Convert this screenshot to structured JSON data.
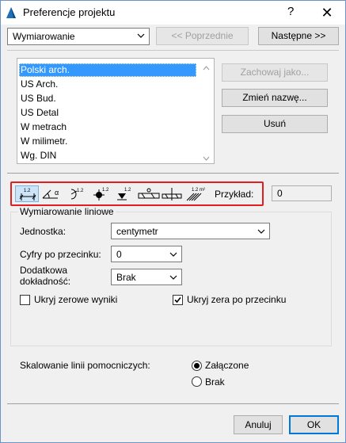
{
  "window": {
    "title": "Preferencje projektu",
    "help_glyph": "?",
    "close_glyph": "✕"
  },
  "top": {
    "category_value": "Wymiarowanie",
    "prev_label": "<< Poprzednie",
    "next_label": "Następne >>"
  },
  "presets": {
    "items": [
      {
        "label": "Polski arch.",
        "selected": true
      },
      {
        "label": "US Arch.",
        "selected": false
      },
      {
        "label": "US Bud.",
        "selected": false
      },
      {
        "label": "US Detal",
        "selected": false
      },
      {
        "label": "W metrach",
        "selected": false
      },
      {
        "label": "W milimetr.",
        "selected": false
      },
      {
        "label": "Wg. DIN",
        "selected": false
      }
    ],
    "save_as_label": "Zachowaj jako...",
    "rename_label": "Zmień nazwę...",
    "delete_label": "Usuń"
  },
  "dim_toolbar": {
    "icons": [
      {
        "name": "linear-dimension-icon",
        "sup": "1.2",
        "active": true
      },
      {
        "name": "angular-dimension-icon",
        "sup": "α",
        "active": false
      },
      {
        "name": "radial-dimension-icon",
        "sup": "1.2",
        "active": false
      },
      {
        "name": "level-dimension-icon",
        "sup": "1.2",
        "active": false
      },
      {
        "name": "elevation-dimension-icon",
        "sup": "1.2",
        "active": false
      },
      {
        "name": "door-window-dimension-icon",
        "sup": "",
        "active": false
      },
      {
        "name": "sill-height-icon",
        "sup": "",
        "active": false
      },
      {
        "name": "area-calculation-icon",
        "sup": "1.2 m²",
        "active": false
      }
    ],
    "example_label": "Przykład:",
    "example_value": "0"
  },
  "linear": {
    "group_title": "Wymiarowanie liniowe",
    "unit_label": "Jednostka:",
    "unit_value": "centymetr",
    "decimals_label": "Cyfry po przecinku:",
    "decimals_value": "0",
    "accuracy_label_line1": "Dodatkowa",
    "accuracy_label_line2": "dokładność:",
    "accuracy_value": "Brak",
    "hide_zero_whole_label": "Ukryj zerowe wyniki",
    "hide_zero_whole_checked": false,
    "hide_zero_decimal_label": "Ukryj zera po przecinku",
    "hide_zero_decimal_checked": true
  },
  "scaling": {
    "label": "Skalowanie linii pomocniczych:",
    "on_label": "Załączone",
    "off_label": "Brak",
    "on_selected": true
  },
  "footer": {
    "cancel_label": "Anuluj",
    "ok_label": "OK"
  }
}
